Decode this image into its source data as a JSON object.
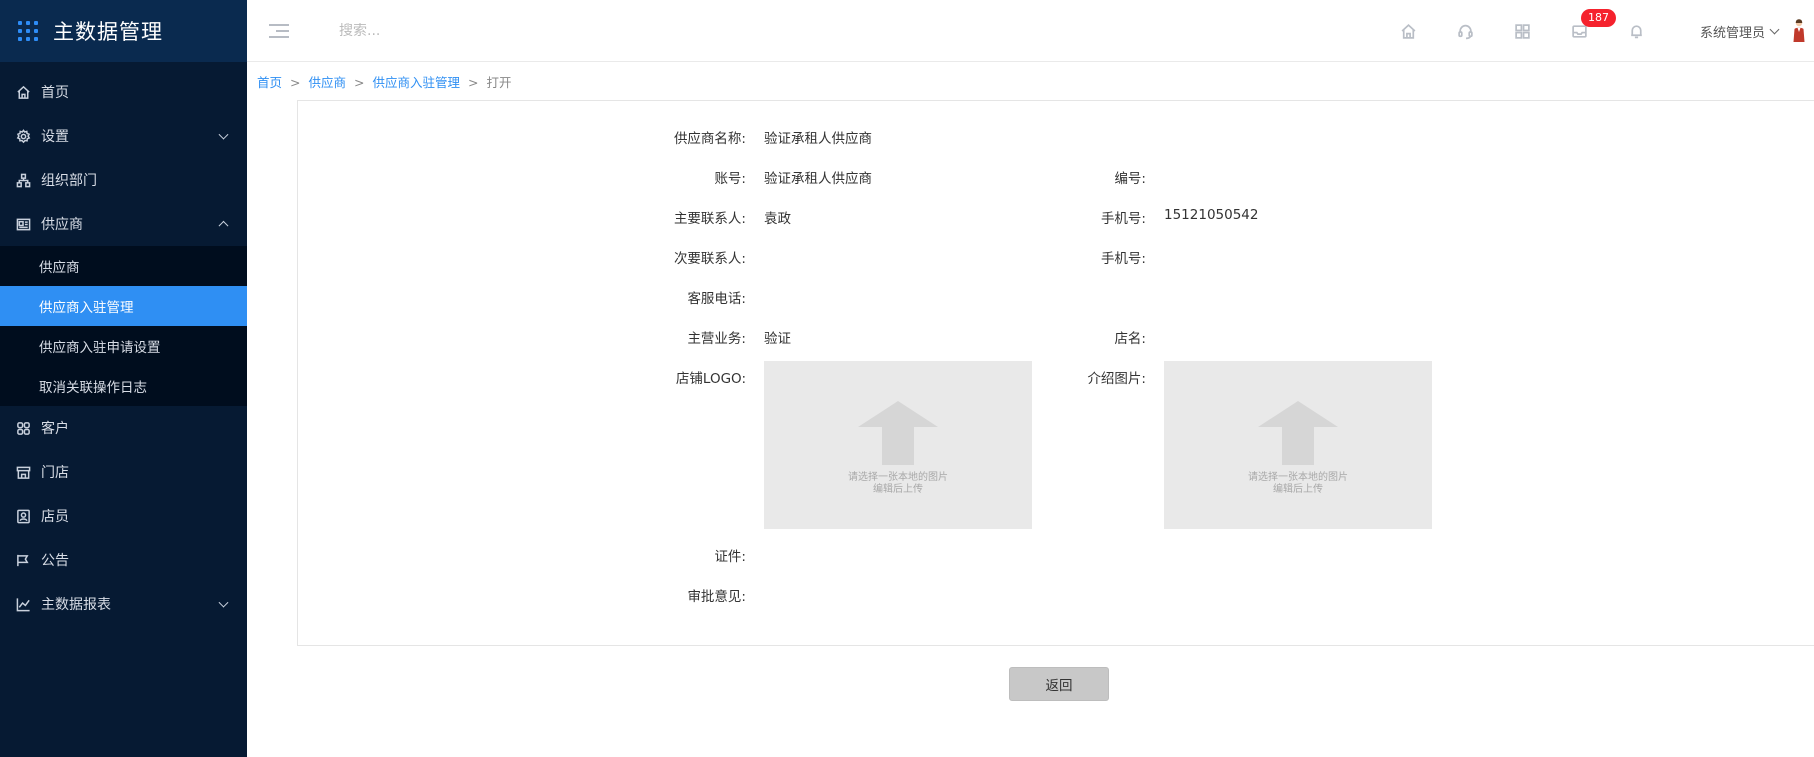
{
  "app": {
    "title": "主数据管理"
  },
  "sidebar": {
    "items": [
      {
        "label": "首页",
        "icon": "home-icon"
      },
      {
        "label": "设置",
        "icon": "gear-icon",
        "expandable": true,
        "expanded": false
      },
      {
        "label": "组织部门",
        "icon": "org-icon"
      },
      {
        "label": "供应商",
        "icon": "supplier-icon",
        "expandable": true,
        "expanded": true,
        "children": [
          {
            "label": "供应商",
            "active": false
          },
          {
            "label": "供应商入驻管理",
            "active": true
          },
          {
            "label": "供应商入驻申请设置",
            "active": false
          },
          {
            "label": "取消关联操作日志",
            "active": false
          }
        ]
      },
      {
        "label": "客户",
        "icon": "customer-icon"
      },
      {
        "label": "门店",
        "icon": "store-icon"
      },
      {
        "label": "店员",
        "icon": "clerk-icon"
      },
      {
        "label": "公告",
        "icon": "announcement-icon"
      },
      {
        "label": "主数据报表",
        "icon": "chart-icon",
        "expandable": true,
        "expanded": false
      }
    ]
  },
  "topbar": {
    "search_placeholder": "搜索...",
    "icons": [
      "home-icon",
      "headset-icon",
      "apps-icon",
      "message-icon",
      "bell-icon"
    ],
    "message_badge": "187",
    "user_name": "系统管理员"
  },
  "breadcrumb": {
    "items": [
      "首页",
      "供应商",
      "供应商入驻管理"
    ],
    "current": "打开",
    "separator": ">"
  },
  "form": {
    "supplier_name": {
      "label": "供应商名称:",
      "value": "验证承租人供应商"
    },
    "account": {
      "label": "账号:",
      "value": "验证承租人供应商"
    },
    "code": {
      "label": "编号:",
      "value": ""
    },
    "primary_contact": {
      "label": "主要联系人:",
      "value": "袁政"
    },
    "primary_phone": {
      "label": "手机号:",
      "value": "15121050542"
    },
    "secondary_contact": {
      "label": "次要联系人:",
      "value": ""
    },
    "secondary_phone": {
      "label": "手机号:",
      "value": ""
    },
    "service_phone": {
      "label": "客服电话:",
      "value": ""
    },
    "main_business": {
      "label": "主营业务:",
      "value": "验证"
    },
    "store_name": {
      "label": "店名:",
      "value": ""
    },
    "store_logo": {
      "label": "店铺LOGO:",
      "hint_line1": "请选择一张本地的图片",
      "hint_line2": "编辑后上传"
    },
    "intro_image": {
      "label": "介绍图片:",
      "hint_line1": "请选择一张本地的图片",
      "hint_line2": "编辑后上传"
    },
    "certificate": {
      "label": "证件:",
      "value": ""
    },
    "approval_opinion": {
      "label": "审批意见:",
      "value": ""
    }
  },
  "actions": {
    "back_label": "返回"
  },
  "colors": {
    "sidebar_bg": "#061a33",
    "brand_bg": "#0a2a4f",
    "accent": "#2f8ff3",
    "badge": "#f5222d"
  }
}
